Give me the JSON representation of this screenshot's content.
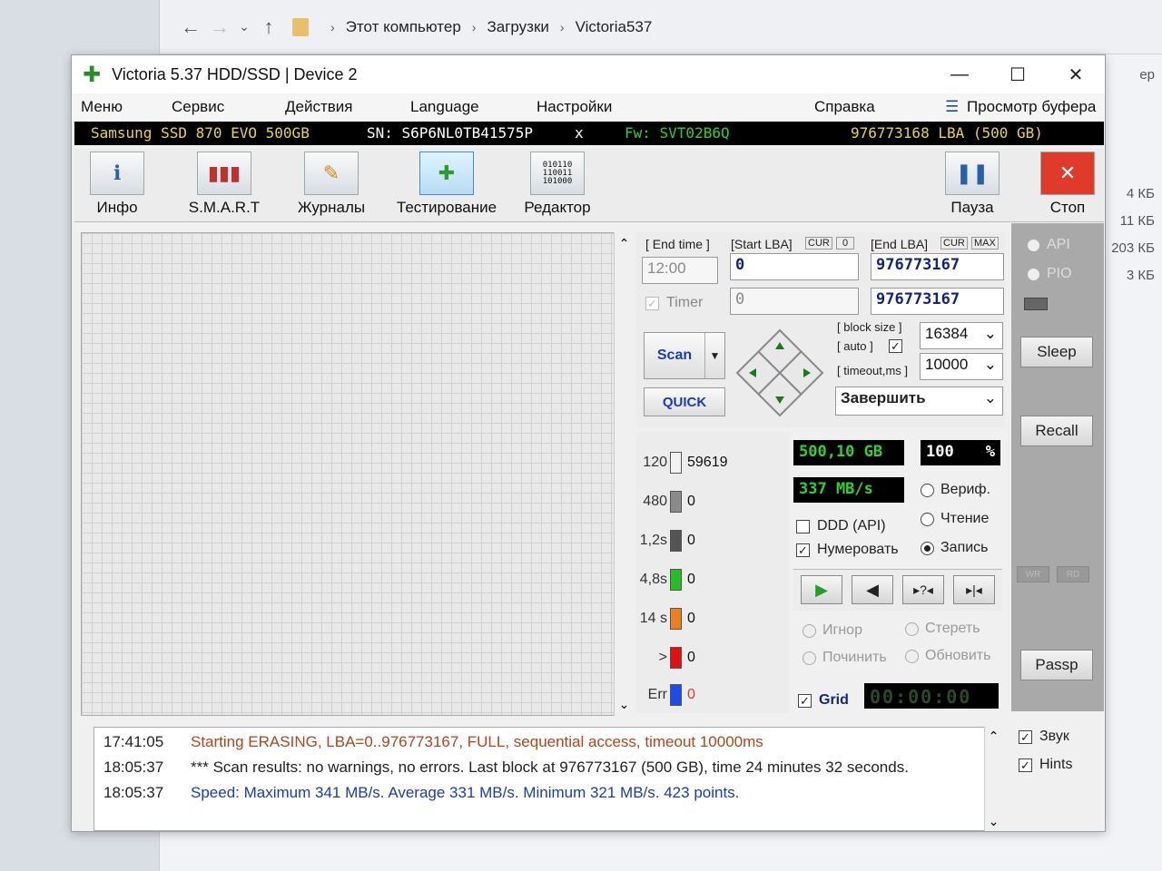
{
  "explorer": {
    "path": [
      "Этот компьютер",
      "Загрузки",
      "Victoria537"
    ],
    "right_partial": "ер",
    "sizes": [
      "4 КБ",
      "11 КБ",
      "203 КБ",
      "3 КБ"
    ]
  },
  "window": {
    "title": "Victoria 5.37 HDD/SSD | Device 2",
    "controls": [
      "—",
      "☐",
      "✕"
    ]
  },
  "menu": [
    "Меню",
    "Сервис",
    "Действия",
    "Language",
    "Настройки",
    "Справка",
    "Просмотр буфера"
  ],
  "device": {
    "model": "Samsung SSD 870 EVO 500GB",
    "serial": "SN: S6P6NL0TB41575P",
    "close": "x",
    "firmware": "Fw: SVT02B6Q",
    "lba": "976773168 LBA (500 GB)"
  },
  "toolbar": {
    "info": "Инфо",
    "smart": "S.M.A.R.T",
    "logs": "Журналы",
    "test": "Тестирование",
    "editor": "Редактор",
    "pause": "Пауза",
    "stop": "Стоп"
  },
  "scan": {
    "end_time_label": "[ End time ]",
    "end_time": "12:00",
    "timer_label": "Timer",
    "start_lba_label": "[Start LBA]",
    "cur": "CUR",
    "start_cur_val": "0",
    "end_lba_label": "[End LBA]",
    "max": "MAX",
    "start_lba": "0",
    "end_lba": "976773167",
    "timer_val": "0",
    "end_lba2": "976773167",
    "block_size_label": "[ block size ]",
    "auto_label": "[ auto ]",
    "timeout_label": "[ timeout,ms ]",
    "block_size": "16384",
    "timeout": "10000",
    "scan_btn": "Scan",
    "quick_btn": "QUICK",
    "finish": "Завершить"
  },
  "legend": [
    {
      "label": "120",
      "count": "59619",
      "color": "#f2f2f2"
    },
    {
      "label": "480",
      "count": "0",
      "color": "#8a8a8a"
    },
    {
      "label": "1,2s",
      "count": "0",
      "color": "#555555"
    },
    {
      "label": "4,8s",
      "count": "0",
      "color": "#22c022"
    },
    {
      "label": "14 s",
      "count": "0",
      "color": "#f07f1a"
    },
    {
      "label": ">",
      "count": "0",
      "color": "#e01010"
    },
    {
      "label": "Err",
      "count": "0",
      "color": "#1a4cf0"
    }
  ],
  "stats": {
    "size": "500,10 GB",
    "percent": "100",
    "pct_sign": "%",
    "speed": "337 MB/s"
  },
  "options": {
    "ddd": "DDD (API)",
    "numerate": "Нумеровать",
    "verify": "Вериф.",
    "read": "Чтение",
    "write": "Запись",
    "ignore": "Игнор",
    "erase": "Стереть",
    "repair": "Починить",
    "refresh": "Обновить",
    "grid": "Grid",
    "clock": "00:00:00"
  },
  "side": {
    "api": "API",
    "pio": "PIO",
    "sleep": "Sleep",
    "recall": "Recall",
    "wr": "WR",
    "rd": "RD",
    "passp": "Passp",
    "sound": "Звук",
    "hints": "Hints"
  },
  "log": [
    {
      "time": "17:41:05",
      "text": "Starting ERASING, LBA=0..976773167, FULL, sequential access, timeout 10000ms",
      "color": "#b0441a"
    },
    {
      "time": "18:05:37",
      "text": "*** Scan results: no warnings, no errors. Last block at 976773167 (500 GB), time 24 minutes 32 seconds.",
      "color": "#222222"
    },
    {
      "time": "18:05:37",
      "text": "Speed: Maximum 341 MB/s. Average 331 MB/s. Minimum 321 MB/s. 423 points.",
      "color": "#1a3ea8"
    }
  ]
}
